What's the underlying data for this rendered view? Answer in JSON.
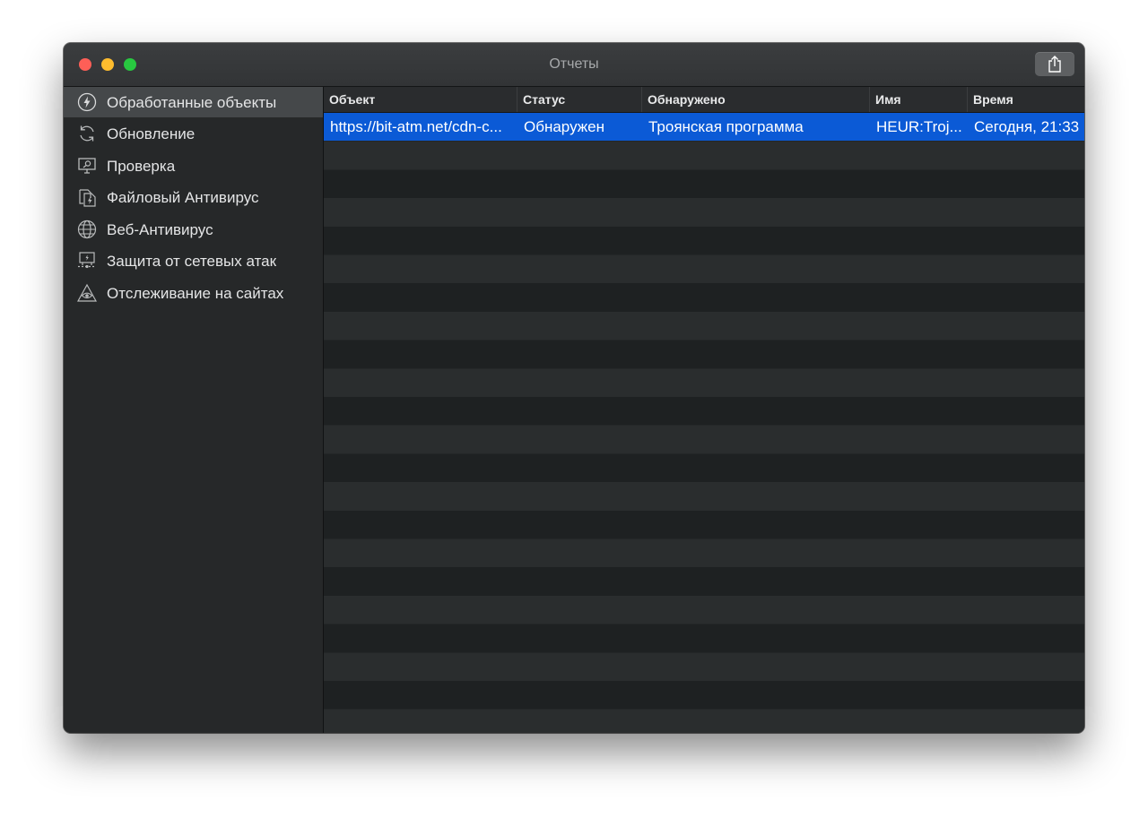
{
  "window": {
    "title": "Отчеты"
  },
  "toolbar": {
    "share_icon": "share-icon"
  },
  "sidebar": {
    "items": [
      {
        "label": "Обработанные объекты",
        "icon": "bolt-circle-icon",
        "active": true
      },
      {
        "label": "Обновление",
        "icon": "refresh-icon",
        "active": false
      },
      {
        "label": "Проверка",
        "icon": "monitor-search-icon",
        "active": false
      },
      {
        "label": "Файловый Антивирус",
        "icon": "file-shield-icon",
        "active": false
      },
      {
        "label": "Веб-Антивирус",
        "icon": "globe-icon",
        "active": false
      },
      {
        "label": "Защита от сетевых атак",
        "icon": "network-shield-icon",
        "active": false
      },
      {
        "label": "Отслеживание на сайтах",
        "icon": "eye-triangle-icon",
        "active": false
      }
    ]
  },
  "table": {
    "columns": [
      "Объект",
      "Статус",
      "Обнаружено",
      "Имя",
      "Время"
    ],
    "rows": [
      {
        "object": "https://bit-atm.net/cdn-c...",
        "status": "Обнаружен",
        "detected": "Троянская программа",
        "name": "HEUR:Troj...",
        "time": "Сегодня, 21:33",
        "selected": true
      }
    ]
  },
  "colors": {
    "selection": "#0b5ad6",
    "close": "#fe5f57",
    "minimize": "#febc2e",
    "zoom": "#28c840"
  }
}
